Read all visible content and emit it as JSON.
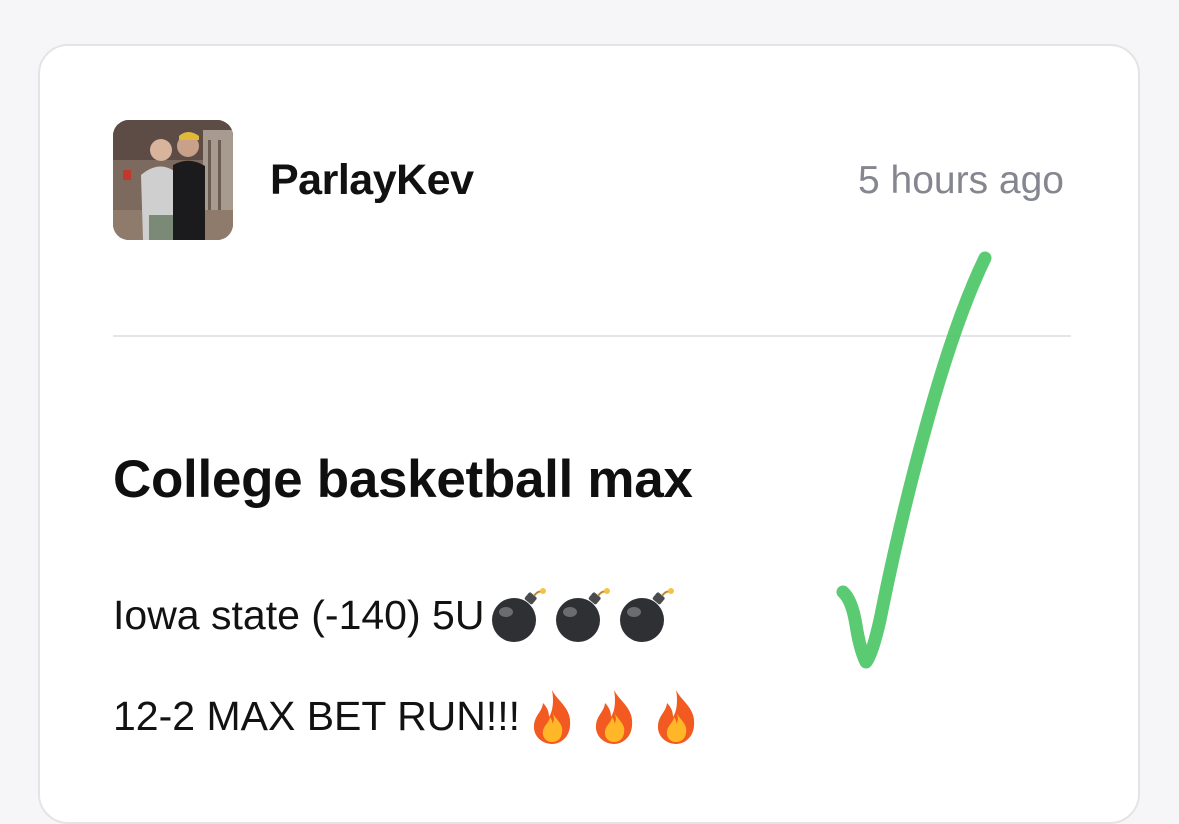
{
  "post": {
    "username": "ParlayKev",
    "timestamp": "5 hours ago",
    "title": "College basketball max",
    "lines": [
      {
        "text": "Iowa state (-140) 5U",
        "emoji": "bomb",
        "emoji_count": 3
      },
      {
        "text": "12-2 MAX BET RUN!!!",
        "emoji": "fire",
        "emoji_count": 3
      }
    ]
  },
  "annotation": {
    "mark": "checkmark",
    "color": "#4cc766"
  }
}
